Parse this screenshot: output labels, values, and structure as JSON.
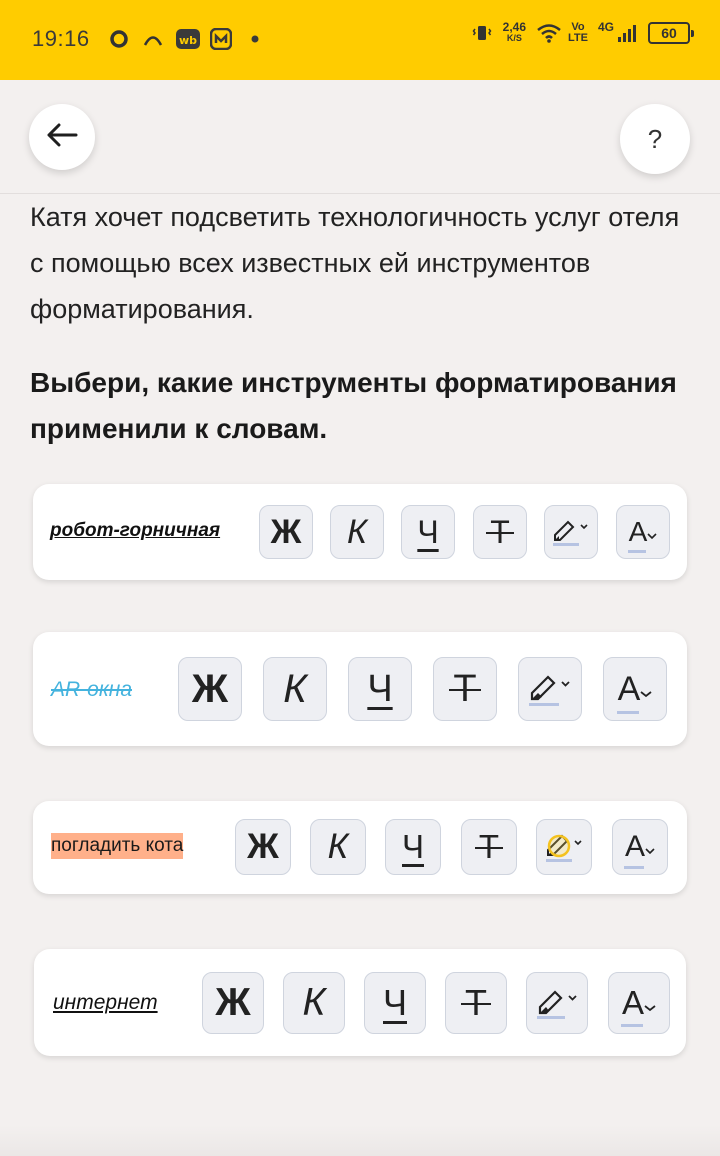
{
  "status_bar": {
    "time": "19:16",
    "net_speed_value": "2,46",
    "net_speed_unit": "K/S",
    "volte_top": "Vo",
    "volte_bottom": "LTE",
    "network": "4G",
    "battery": "60"
  },
  "header": {
    "back_icon": "arrow-left-icon",
    "help_label": "?"
  },
  "question_text": "Катя хочет подсветить технологичность услуг отеля с помощью всех известных ей инструментов форматирования.",
  "task_text": "Выбери, какие инструменты форматирования применили к словам.",
  "toolbar_labels": {
    "bold": "Ж",
    "italic": "К",
    "underline": "Ч",
    "strike": "Т",
    "text_color": "А"
  },
  "rows": [
    {
      "word": "робот-горничная"
    },
    {
      "word": "AR-окна"
    },
    {
      "word": "погладить кота"
    },
    {
      "word": "интернет"
    }
  ],
  "colors": {
    "brand_yellow": "#ffcc00",
    "ar_text": "#44b3de",
    "highlight_bg": "#ffb08a"
  }
}
